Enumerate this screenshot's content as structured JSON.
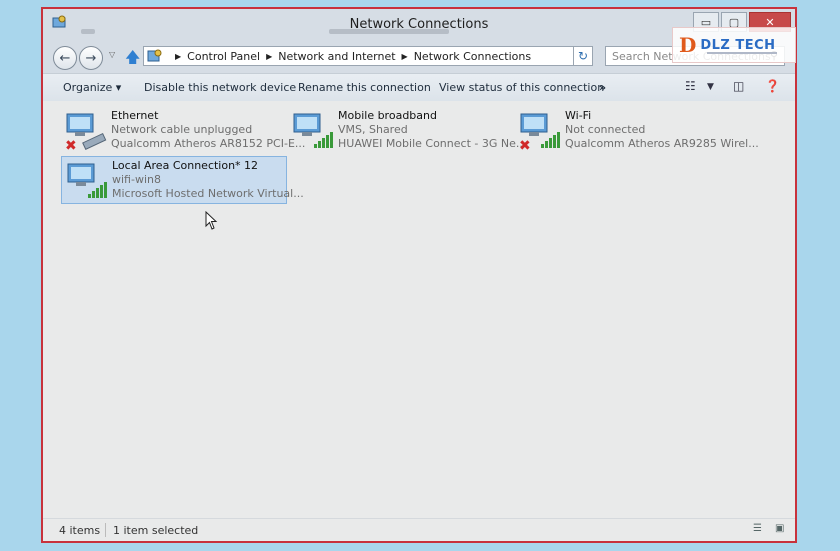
{
  "window": {
    "title": "Network Connections",
    "minimize": "▭",
    "maximize": "▢",
    "close": "✕"
  },
  "address": {
    "crumbs": [
      "Control Panel",
      "Network and Internet",
      "Network Connections"
    ],
    "search_placeholder": "Search Network Connections"
  },
  "commands": {
    "organize": "Organize ▾",
    "disable": "Disable this network device",
    "rename": "Rename this connection",
    "view_status": "View status of this connection",
    "more": "»"
  },
  "connections": [
    {
      "name": "Ethernet",
      "status": "Network cable unplugged",
      "device": "Qualcomm Atheros AR8152 PCI-E...",
      "error": true,
      "signal": false
    },
    {
      "name": "Mobile broadband",
      "status": "VMS, Shared",
      "device": "HUAWEI Mobile Connect - 3G Ne...",
      "error": false,
      "signal": true
    },
    {
      "name": "Wi-Fi",
      "status": "Not connected",
      "device": "Qualcomm Atheros AR9285 Wirel...",
      "error": true,
      "signal": true
    },
    {
      "name": "Local Area Connection* 12",
      "status": "wifi-win8",
      "device": "Microsoft Hosted Network Virtual...",
      "error": false,
      "signal": true,
      "selected": true
    }
  ],
  "statusbar": {
    "item_count": "4 items",
    "selection": "1 item selected"
  },
  "watermark": {
    "brand": "DLZ TECH"
  },
  "colors": {
    "frame_border": "#c8323c",
    "selection_bg": "#c9dcef",
    "desktop_bg": "#a9d6ec"
  }
}
